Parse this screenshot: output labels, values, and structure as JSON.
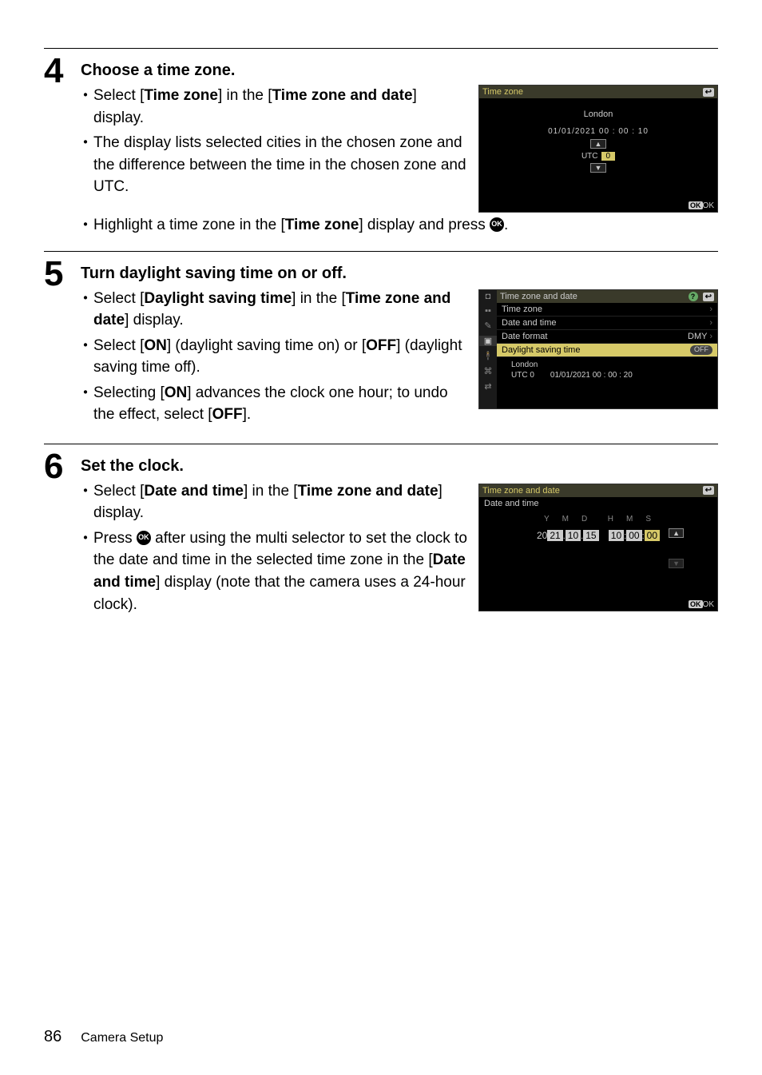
{
  "steps": {
    "s4": {
      "num": "4",
      "heading": "Choose a time zone.",
      "b1_pre": "Select [",
      "b1_bold1": "Time zone",
      "b1_mid": "] in the [",
      "b1_bold2": "Time zone and date",
      "b1_post": "] display.",
      "b2": "The display lists selected cities in the chosen zone and the difference between the time in the chosen zone and UTC.",
      "b3_pre": "Highlight a time zone in the [",
      "b3_bold": "Time zone",
      "b3_post": "] display and press ",
      "b3_end": "."
    },
    "s5": {
      "num": "5",
      "heading": "Turn daylight saving time on or off.",
      "b1_pre": "Select [",
      "b1_bold1": "Daylight saving time",
      "b1_mid": "] in the [",
      "b1_bold2": "Time zone and date",
      "b1_post": "] display.",
      "b2_pre": "Select [",
      "b2_bold1": "ON",
      "b2_mid": "] (daylight saving time on) or [",
      "b2_bold2": "OFF",
      "b2_post": "] (daylight saving time off).",
      "b3_pre": "Selecting [",
      "b3_bold1": "ON",
      "b3_mid": "] advances the clock one hour; to undo the effect, select [",
      "b3_bold2": "OFF",
      "b3_post": "]."
    },
    "s6": {
      "num": "6",
      "heading": "Set the clock.",
      "b1_pre": "Select [",
      "b1_bold1": "Date and time",
      "b1_mid": "] in the [",
      "b1_bold2": "Time zone and date",
      "b1_post": "] display.",
      "b2_pre": "Press ",
      "b2_mid": " after using the multi selector to set the clock to the date and time in the selected time zone in the [",
      "b2_bold": "Date and time",
      "b2_post": "] display (note that the camera uses a 24-hour clock)."
    }
  },
  "lcd1": {
    "title": "Time zone",
    "back": "↩",
    "city": "London",
    "datetime": "01/01/2021  00 : 00 : 10",
    "up": "▲",
    "utc_label": "UTC",
    "utc_val": "0",
    "down": "▼",
    "ok": "OK"
  },
  "lcd2": {
    "side_icons": [
      "◘",
      "▪▪",
      "✎",
      "▣",
      "🕴",
      "⌘",
      "⇄"
    ],
    "hdr": "Time zone and date",
    "help": "?",
    "back": "↩",
    "rows": [
      {
        "label": "Time zone",
        "val": "",
        "chev": "›"
      },
      {
        "label": "Date and time",
        "val": "",
        "chev": "›"
      },
      {
        "label": "Date format",
        "val": "DMY",
        "chev": "›"
      },
      {
        "label": "Daylight saving time",
        "val": "OFF",
        "chev": "",
        "hl": true
      }
    ],
    "city": "London",
    "utc": "UTC  0",
    "dt": "01/01/2021  00 : 00 : 20"
  },
  "lcd3": {
    "title": "Time zone and date",
    "back": "↩",
    "sub": "Date and time",
    "labels": [
      "Y",
      "M",
      "D",
      "H",
      "M",
      "S"
    ],
    "yprefix": "20",
    "yy": "21",
    "mm": "10",
    "dd": "15",
    "hh": "10",
    "mi": "00",
    "ss": "00",
    "up": "▲",
    "down": "▼",
    "ok": "OK"
  },
  "footer": {
    "page": "86",
    "label": "Camera Setup"
  },
  "glyphs": {
    "ok": "OK"
  }
}
